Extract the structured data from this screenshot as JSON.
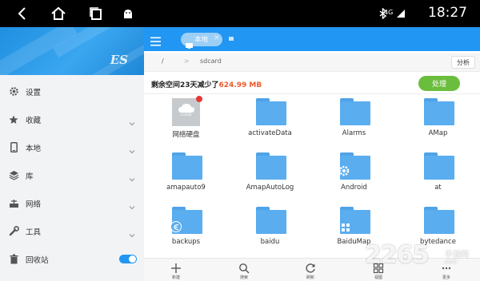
{
  "status_bar": {
    "time": "18:27",
    "signal_text": "4G",
    "icons": [
      "back-icon",
      "home-icon",
      "recents-icon",
      "android-icon",
      "bluetooth-icon",
      "signal-icon"
    ]
  },
  "sidebar": {
    "items": [
      {
        "label": "设置",
        "icon": "gear-icon"
      },
      {
        "label": "收藏",
        "icon": "star-icon"
      },
      {
        "label": "本地",
        "icon": "phone-icon"
      },
      {
        "label": "库",
        "icon": "layers-icon"
      },
      {
        "label": "网络",
        "icon": "network-icon"
      },
      {
        "label": "工具",
        "icon": "wrench-icon"
      },
      {
        "label": "回收站",
        "icon": "trash-icon"
      }
    ]
  },
  "topbar": {
    "tab_label": "本地",
    "tab_close": "✕"
  },
  "path": {
    "root": "/",
    "separator": ">",
    "current": "sdcard",
    "analyze_label": "分析"
  },
  "storage": {
    "message_prefix": "剩余空间23天减少了",
    "amount": "624.99 MB",
    "process_label": "处理"
  },
  "files": [
    {
      "name": "网络硬盘",
      "type": "cloud",
      "tile_text": "CLOUD"
    },
    {
      "name": "activateData",
      "type": "folder"
    },
    {
      "name": "Alarms",
      "type": "folder"
    },
    {
      "name": "AMap",
      "type": "folder"
    },
    {
      "name": "amapauto9",
      "type": "folder"
    },
    {
      "name": "AmapAutoLog",
      "type": "folder"
    },
    {
      "name": "Android",
      "type": "folder",
      "badge": "gear"
    },
    {
      "name": "at",
      "type": "folder"
    },
    {
      "name": "backups",
      "type": "folder",
      "badge": "es"
    },
    {
      "name": "baidu",
      "type": "folder"
    },
    {
      "name": "BaiduMap",
      "type": "folder",
      "badge": "grid"
    },
    {
      "name": "bytedance",
      "type": "folder"
    }
  ],
  "bottom_bar": [
    {
      "label": "新建",
      "icon": "plus-icon"
    },
    {
      "label": "搜索",
      "icon": "search-icon"
    },
    {
      "label": "刷新",
      "icon": "refresh-icon"
    },
    {
      "label": "视图",
      "icon": "view-icon"
    },
    {
      "label": "更多",
      "icon": "more-icon"
    }
  ],
  "watermark": {
    "number": "2265",
    "suffix": ".com",
    "cn": "手游网"
  },
  "colors": {
    "accent": "#2196f3",
    "folder": "#5aadef",
    "process_button": "#6bbd3d",
    "amount": "#f0592b"
  }
}
